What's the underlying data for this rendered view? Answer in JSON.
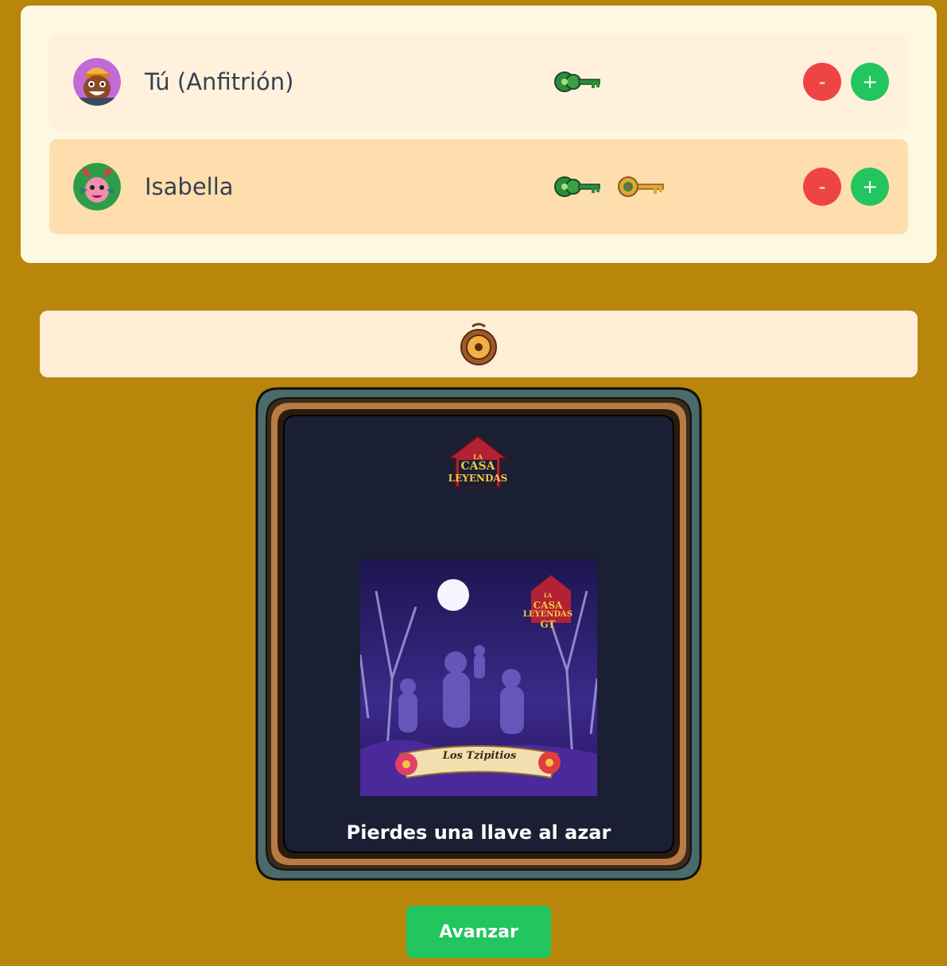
{
  "players": [
    {
      "name": "Tú (Anfitrión)",
      "avatar_icon": "goblin-avatar-icon",
      "keys": [
        "jade-key-icon"
      ],
      "minus_label": "-",
      "plus_label": "+"
    },
    {
      "name": "Isabella",
      "avatar_icon": "pink-creature-avatar-icon",
      "keys": [
        "jade-key-icon",
        "gold-key-icon"
      ],
      "minus_label": "-",
      "plus_label": "+"
    }
  ],
  "token_icon": "compass-token-icon",
  "card": {
    "logo_text": [
      "LA",
      "CASA",
      "LEYENDAS"
    ],
    "image_logo_text": [
      "LA",
      "CASA",
      "LEYENDAS",
      "GT"
    ],
    "banner_text": "Los Tzipitios",
    "text": "Pierdes una llave al azar"
  },
  "advance_label": "Avanzar",
  "colors": {
    "background": "#b8860b",
    "panel": "#fff8e1",
    "row_highlight": "#ffdeae",
    "minus": "#ef4444",
    "plus": "#22c55e",
    "card_bg": "#1a1f33"
  }
}
